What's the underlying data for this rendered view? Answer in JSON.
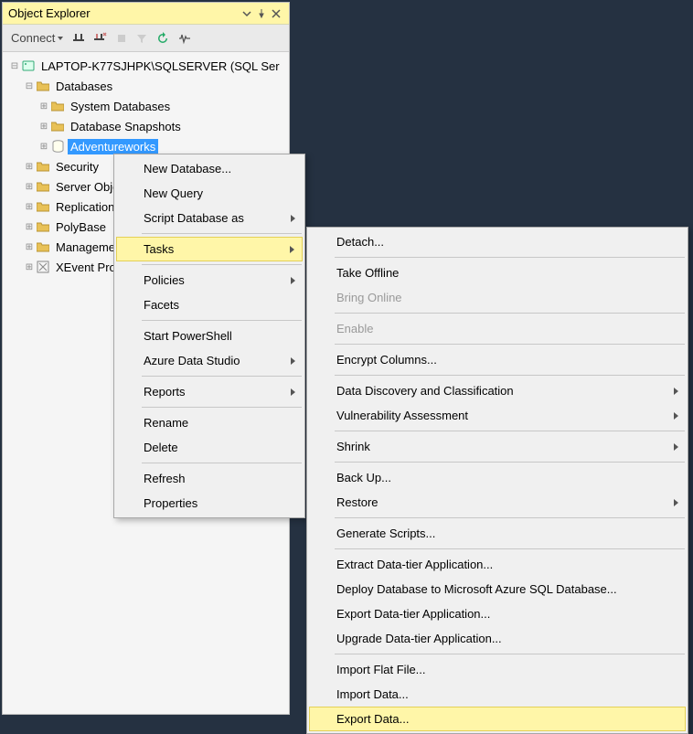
{
  "panel": {
    "title": "Object Explorer"
  },
  "toolbar": {
    "connect": "Connect"
  },
  "tree": {
    "server": "LAPTOP-K77SJHPK\\SQLSERVER (SQL Ser",
    "databases": "Databases",
    "system_dbs": "System Databases",
    "snapshots": "Database Snapshots",
    "adventureworks": "Adventureworks",
    "security": "Security",
    "server_obj": "Server Objects",
    "replica": "Replication",
    "polybase": "PolyBase",
    "manage": "Management",
    "xevent": "XEvent Profiler"
  },
  "menu1": {
    "new_db": "New Database...",
    "new_query": "New Query",
    "script_as": "Script Database as",
    "tasks": "Tasks",
    "policies": "Policies",
    "facets": "Facets",
    "start_ps": "Start PowerShell",
    "azure_ds": "Azure Data Studio",
    "reports": "Reports",
    "rename": "Rename",
    "delete": "Delete",
    "refresh": "Refresh",
    "properties": "Properties"
  },
  "menu2": {
    "detach": "Detach...",
    "take_offline": "Take Offline",
    "bring_online": "Bring Online",
    "enable": "Enable",
    "encrypt": "Encrypt Columns...",
    "ddc": "Data Discovery and Classification",
    "vuln": "Vulnerability Assessment",
    "shrink": "Shrink",
    "backup": "Back Up...",
    "restore": "Restore",
    "gen_scripts": "Generate Scripts...",
    "extract_dt": "Extract Data-tier Application...",
    "deploy_azure": "Deploy Database to Microsoft Azure SQL Database...",
    "export_dt": "Export Data-tier Application...",
    "upgrade_dt": "Upgrade Data-tier Application...",
    "import_flat": "Import Flat File...",
    "import_data": "Import Data...",
    "export_data": "Export Data..."
  }
}
